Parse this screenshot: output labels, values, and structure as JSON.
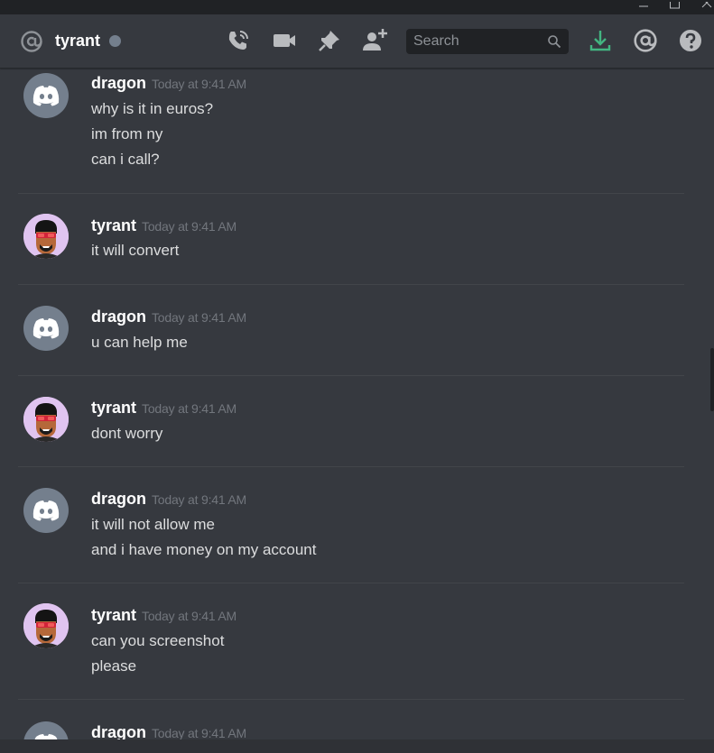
{
  "window": {
    "controls": [
      "minimize",
      "maximize",
      "close"
    ]
  },
  "header": {
    "channel_name": "tyrant",
    "status": "offline",
    "search_placeholder": "Search",
    "icons": [
      "at-sign-icon",
      "phone-call-icon",
      "video-call-icon",
      "pin-icon",
      "add-friend-icon",
      "search-icon",
      "download-icon",
      "mentions-icon",
      "help-icon"
    ]
  },
  "colors": {
    "background": "#36393f",
    "titlebar": "#202225",
    "search_bg": "#202225",
    "username": "#ffffff",
    "timestamp": "#72767d",
    "message_text": "#dcddde",
    "discord_avatar_bg": "#747f8d",
    "download_icon": "#43b581",
    "status_offline": "#747f8d"
  },
  "messages": [
    {
      "author": "dragon",
      "timestamp": "Today at 9:41 AM",
      "avatar": "discord-default-avatar",
      "lines": [
        "why is it in euros?",
        "im from ny",
        "can i call?"
      ]
    },
    {
      "author": "tyrant",
      "timestamp": "Today at 9:41 AM",
      "avatar": "tyrant-avatar",
      "lines": [
        "it will convert"
      ]
    },
    {
      "author": "dragon",
      "timestamp": "Today at 9:41 AM",
      "avatar": "discord-default-avatar",
      "lines": [
        "u can help me"
      ]
    },
    {
      "author": "tyrant",
      "timestamp": "Today at 9:41 AM",
      "avatar": "tyrant-avatar",
      "lines": [
        "dont worry"
      ]
    },
    {
      "author": "dragon",
      "timestamp": "Today at 9:41 AM",
      "avatar": "discord-default-avatar",
      "lines": [
        "it will not allow me",
        "and i have money on my account"
      ]
    },
    {
      "author": "tyrant",
      "timestamp": "Today at 9:41 AM",
      "avatar": "tyrant-avatar",
      "lines": [
        "can you screenshot",
        "please"
      ]
    },
    {
      "author": "dragon",
      "timestamp": "Today at 9:41 AM",
      "avatar": "discord-default-avatar",
      "lines": []
    }
  ]
}
